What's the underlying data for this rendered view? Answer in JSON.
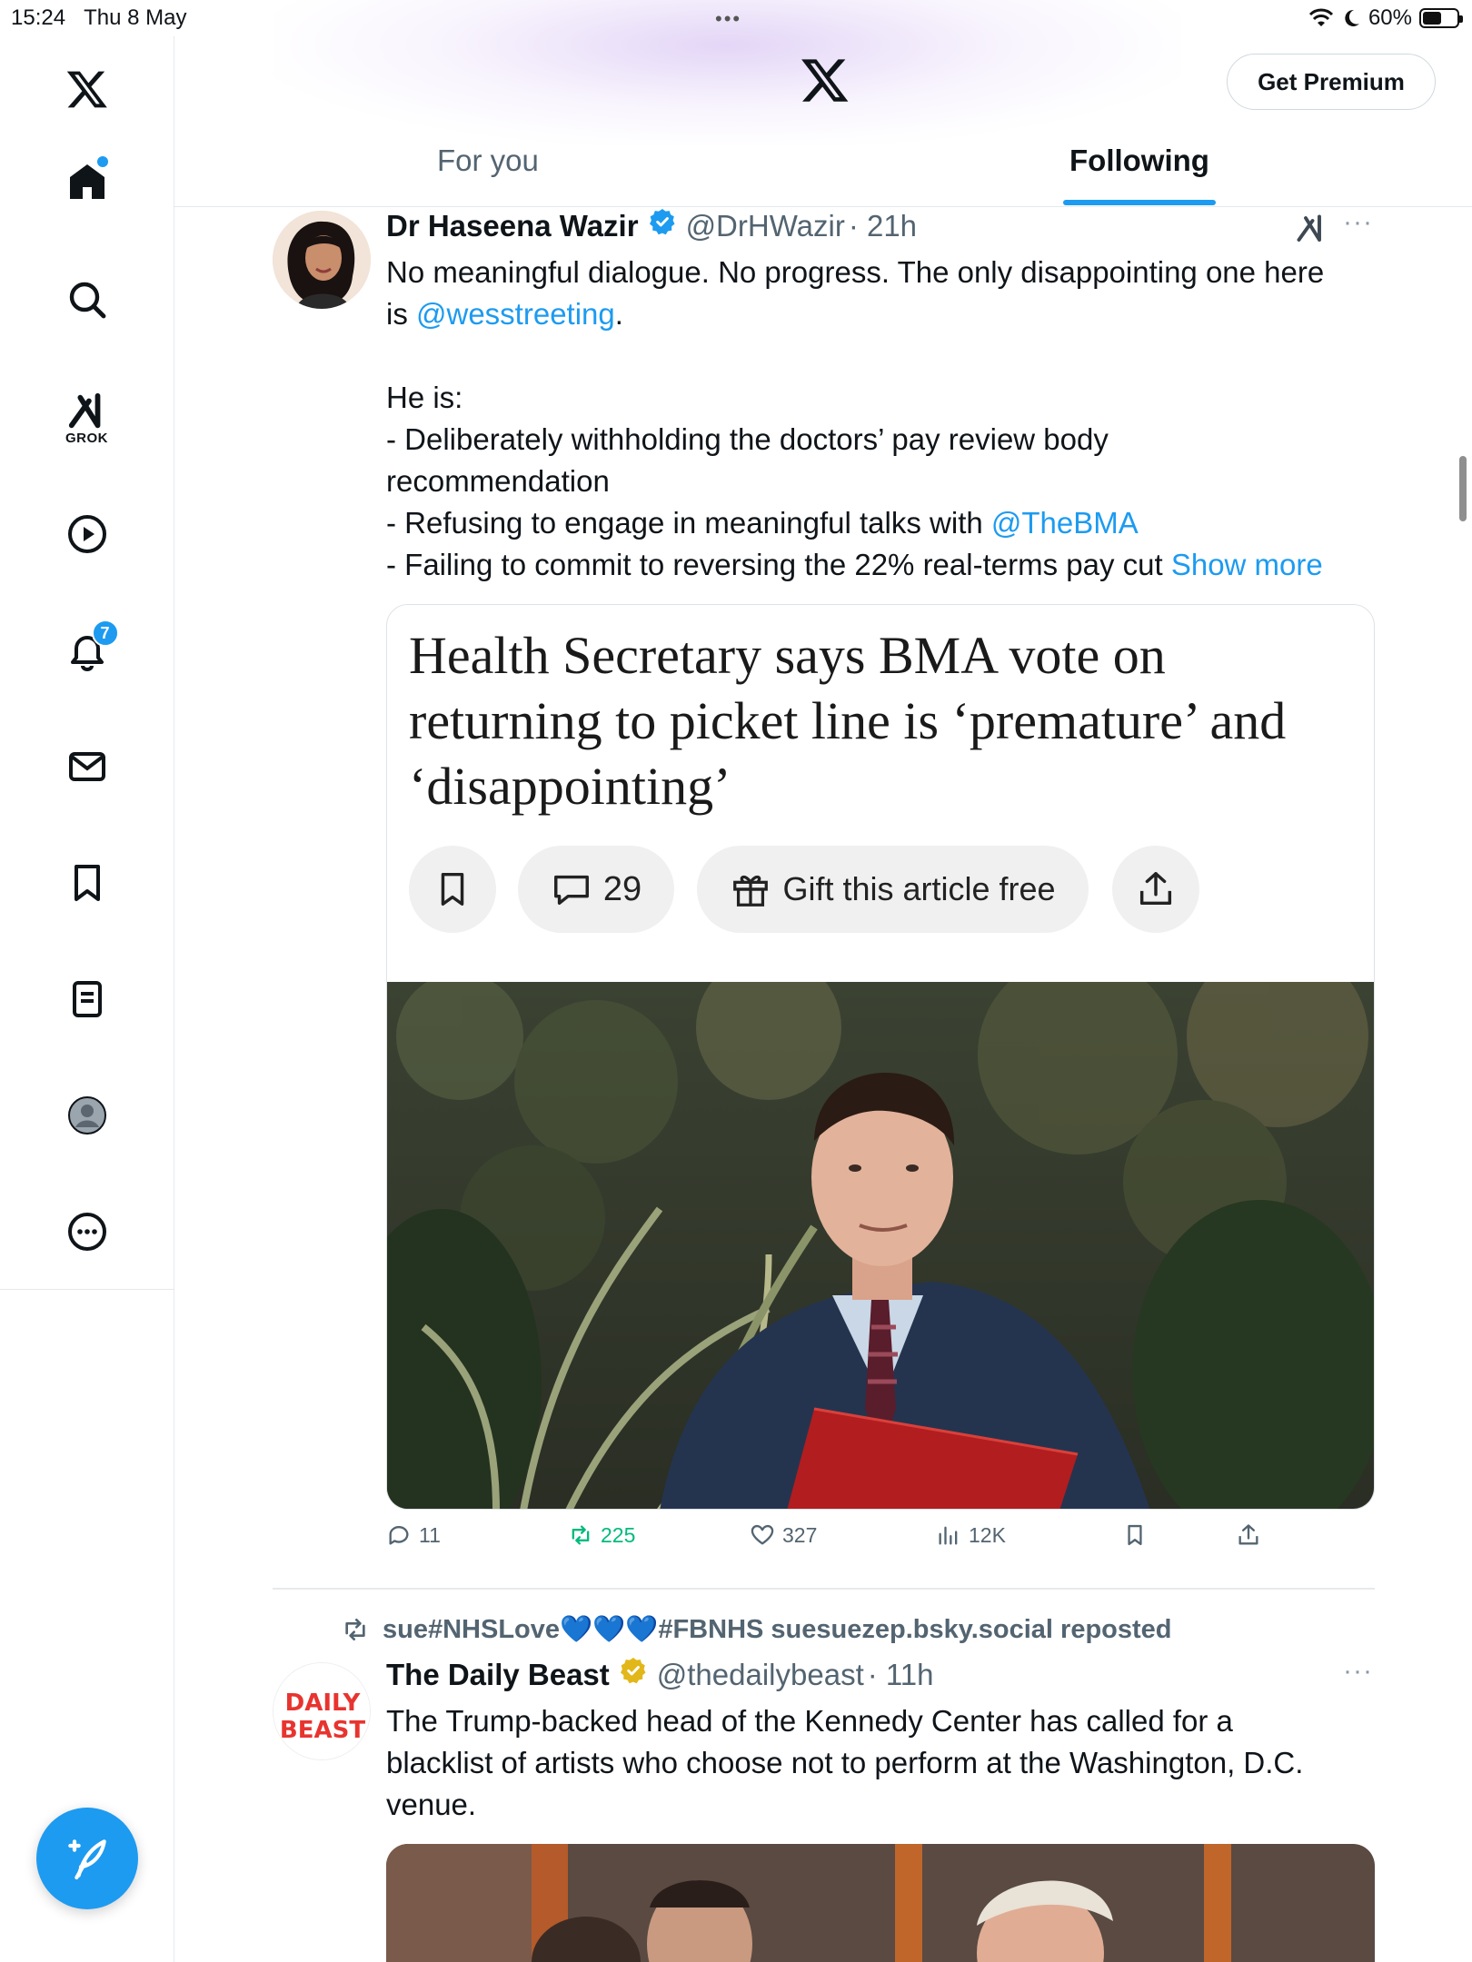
{
  "status_bar": {
    "time": "15:24",
    "date": "Thu 8 May",
    "battery": "60%",
    "battery_level": 0.6
  },
  "header": {
    "premium_label": "Get Premium",
    "tabs": [
      {
        "label": "For you",
        "active": false
      },
      {
        "label": "Following",
        "active": true
      }
    ]
  },
  "sidebar": {
    "grok_label": "GROK",
    "notifications_count": "7",
    "icons": [
      "x-logo-icon",
      "home-icon",
      "search-icon",
      "grok-icon",
      "video-icon",
      "notifications-icon",
      "messages-icon",
      "bookmarks-icon",
      "lists-icon",
      "profile-icon",
      "more-icon",
      "compose-icon"
    ]
  },
  "post1": {
    "name": "Dr Haseena Wazir",
    "handle": "@DrHWazir",
    "time": "· 21h",
    "line1": "No meaningful dialogue. No progress. The only disappointing one here",
    "line2_pre": "is ",
    "mention1": "@wesstreeting",
    "line2_post": ".",
    "line3": "He is:",
    "line4": "- Deliberately withholding the doctors’ pay review body",
    "line5": "recommendation",
    "line6_pre": "- Refusing to engage in meaningful talks with ",
    "mention2": "@TheBMA",
    "line7": "- Failing to commit to reversing the 22% real-terms pay cut ",
    "show_more": "Show more",
    "card": {
      "headline": "Health Secretary says BMA vote on returning to picket line is ‘premature’ and ‘disappointing’",
      "comments": "29",
      "gift": "Gift this article free"
    },
    "stats": {
      "replies": "11",
      "reposts": "225",
      "likes": "327",
      "views": "12K"
    }
  },
  "post2": {
    "repost_text": "sue#NHSLove💙💙💙#FBNHS suesuezep.bsky.social reposted",
    "name": "The Daily Beast",
    "handle": "@thedailybeast",
    "time": "· 11h",
    "avatar_text_1": "DAILY",
    "avatar_text_2": "BEAST",
    "line1": "The Trump-backed head of the Kennedy Center has called for a",
    "line2": "blacklist of artists who choose not to perform at the Washington, D.C.",
    "line3": "venue."
  },
  "colors": {
    "accent": "#1d9bf0",
    "text": "#0f1419",
    "muted": "#536471",
    "repost_green": "#00ba7c",
    "gold_verified": "#e2b719"
  }
}
